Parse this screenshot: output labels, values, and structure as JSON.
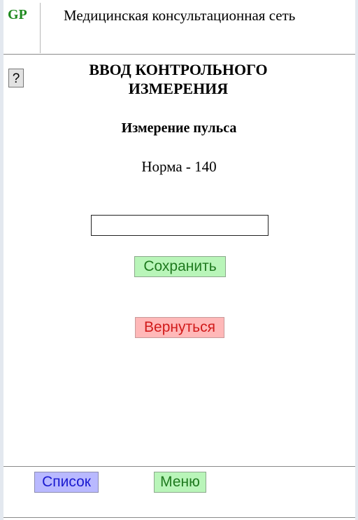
{
  "header": {
    "logo": "GP",
    "title": "Медицинская консультационная сеть"
  },
  "help": {
    "label": "?"
  },
  "page": {
    "title_line1": "ВВОД КОНТРОЛЬНОГО",
    "title_line2": "ИЗМЕРЕНИЯ",
    "subtitle": "Измерение пульса",
    "norm": "Норма - 140"
  },
  "form": {
    "value": "",
    "placeholder": ""
  },
  "buttons": {
    "save": "Сохранить",
    "back": "Вернуться"
  },
  "footer": {
    "list": "Список",
    "menu": "Меню"
  },
  "colors": {
    "logo": "#1f8a1f",
    "save_bg": "#b9f5b9",
    "back_bg": "#ffb8b8",
    "list_bg": "#b9b9ff",
    "menu_bg": "#b9f5b9"
  }
}
